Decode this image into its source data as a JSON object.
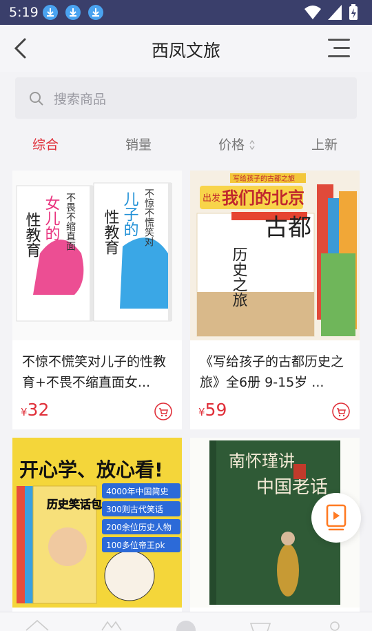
{
  "status": {
    "time": "5:19"
  },
  "header": {
    "title": "西凤文旅"
  },
  "search": {
    "placeholder": "搜索商品"
  },
  "tabs": [
    {
      "label": "综合",
      "active": true
    },
    {
      "label": "销量",
      "active": false
    },
    {
      "label": "价格",
      "active": false
    },
    {
      "label": "上新",
      "active": false
    }
  ],
  "products": [
    {
      "name": "不惊不慌笑对儿子的性教育+不畏不缩直面女...",
      "currency": "¥",
      "price": "32",
      "cover_texts": [
        "性教育",
        "女儿的",
        "性教育",
        "儿子的",
        "不畏不缩直面",
        "不惊不慌笑对"
      ]
    },
    {
      "name": "《写给孩子的古都历史之旅》全6册 9-15岁 ...",
      "currency": "¥",
      "price": "59",
      "cover_texts": [
        "写给孩子的古都之旅",
        "出发",
        "我们的北京",
        "古都",
        "历史之旅"
      ]
    },
    {
      "name": "",
      "currency": "",
      "price": "",
      "cover_texts": [
        "开心学、放心看!",
        "历史笑话包",
        "4000年中国简史",
        "300则古代笑话",
        "200余位历史人物",
        "100多位帝王pk"
      ]
    },
    {
      "name": "",
      "currency": "",
      "price": "",
      "cover_texts": [
        "南怀瑾讲",
        "中国老话"
      ]
    }
  ],
  "colors": {
    "accent": "#e0303a",
    "statusbar": "#3a3f6b",
    "float_icon": "#ff7a22"
  }
}
